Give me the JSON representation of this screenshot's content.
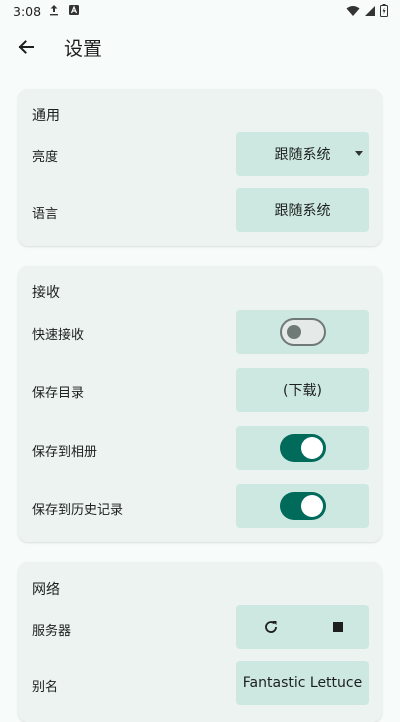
{
  "status_bar": {
    "time": "3:08"
  },
  "app_bar": {
    "title": "设置"
  },
  "sections": {
    "general": {
      "title": "通用",
      "brightness_label": "亮度",
      "brightness_value": "跟随系统",
      "language_label": "语言",
      "language_value": "跟随系统"
    },
    "receive": {
      "title": "接收",
      "quick_receive_label": "快速接收",
      "quick_receive_on": false,
      "save_dir_label": "保存目录",
      "save_dir_value": "(下载)",
      "save_album_label": "保存到相册",
      "save_album_on": true,
      "save_history_label": "保存到历史记录",
      "save_history_on": true
    },
    "network": {
      "title": "网络",
      "server_label": "服务器",
      "alias_label": "别名",
      "alias_value": "Fantastic Lettuce"
    }
  },
  "colors": {
    "accent": "#006b5b",
    "control_bg": "#cde8e0",
    "card_bg": "#ecf3f0",
    "page_bg": "#f7fbf9"
  }
}
